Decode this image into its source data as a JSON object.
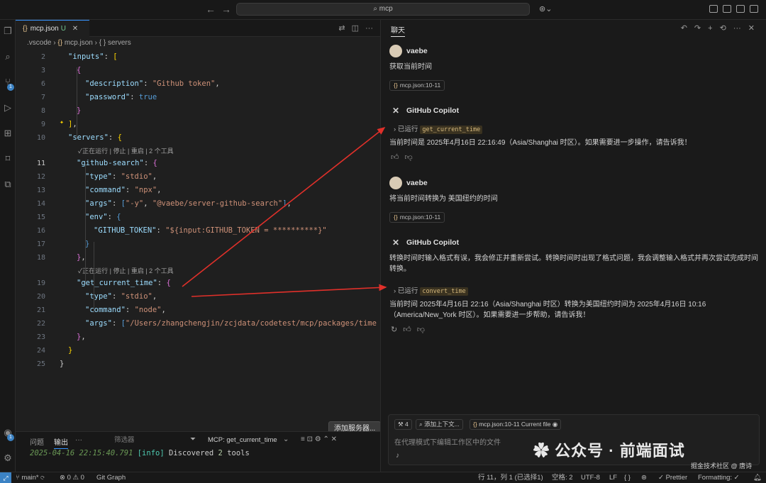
{
  "titlebar": {
    "search": "⌕ mcp"
  },
  "activity": {
    "scm_badge": "1",
    "account_badge": "1"
  },
  "editor": {
    "tab_label": "mcp.json",
    "tab_status": "U",
    "breadcrumb": [
      ".vscode",
      "mcp.json",
      "{ } servers"
    ],
    "lines": [
      {
        "n": "2",
        "html": "<span class='k'>\"inputs\"</span>: <span class='y'>[</span>"
      },
      {
        "n": "3",
        "html": "  <span class='p'>{</span>"
      },
      {
        "n": "6",
        "html": "    <span class='k'>\"description\"</span>: <span class='s'>\"Github token\"</span>,"
      },
      {
        "n": "7",
        "html": "    <span class='k'>\"password\"</span>: <span class='b'>true</span>"
      },
      {
        "n": "8",
        "html": "  <span class='p'>}</span>"
      },
      {
        "n": "9",
        "html": "<span class='y'>]</span>,"
      },
      {
        "n": "10",
        "html": "<span class='k'>\"servers\"</span>: <span class='y'>{</span>"
      },
      {
        "n": "11",
        "html": "  <span class='k'>\"github-search\"</span>: <span class='p'>{</span>"
      },
      {
        "n": "12",
        "html": "    <span class='k'>\"type\"</span>: <span class='s'>\"stdio\"</span>,"
      },
      {
        "n": "13",
        "html": "    <span class='k'>\"command\"</span>: <span class='s'>\"npx\"</span>,"
      },
      {
        "n": "14",
        "html": "    <span class='k'>\"args\"</span>: <span class='b'>[</span><span class='s'>\"-y\"</span>, <span class='s'>\"@vaebe/server-github-search\"</span><span class='b'>]</span>,"
      },
      {
        "n": "15",
        "html": "    <span class='k'>\"env\"</span>: <span class='b'>{</span>"
      },
      {
        "n": "16",
        "html": "      <span class='k'>\"GITHUB_TOKEN\"</span>: <span class='s'>\"${input:GITHUB_TOKEN = **********}\"</span>"
      },
      {
        "n": "17",
        "html": "    <span class='b'>}</span>"
      },
      {
        "n": "18",
        "html": "  <span class='p'>}</span>,"
      },
      {
        "n": "19",
        "html": "  <span class='k'>\"get_current_time\"</span>: <span class='p'>{</span>"
      },
      {
        "n": "20",
        "html": "    <span class='k'>\"type\"</span>: <span class='s'>\"stdio\"</span>,"
      },
      {
        "n": "21",
        "html": "    <span class='k'>\"command\"</span>: <span class='s'>\"node\"</span>,"
      },
      {
        "n": "22",
        "html": "    <span class='k'>\"args\"</span>: <span class='b'>[</span><span class='s'>\"/Users/zhangchengjin/zcjdata/codetest/mcp/packages/time</span>"
      },
      {
        "n": "23",
        "html": "  <span class='p'>}</span>,"
      },
      {
        "n": "24",
        "html": "<span class='y'>}</span>"
      },
      {
        "n": "25",
        "html": "}"
      },
      {
        "n": "26",
        "html": ""
      }
    ],
    "lens_1": "✓正在运行 | 停止 | 重启 | 2 个工具",
    "lens_2": "✓正在运行 | 停止 | 重启 | 2 个工具",
    "add_server": "添加服务器..."
  },
  "panel": {
    "tabs": [
      "问题",
      "输出",
      "···"
    ],
    "filter_placeholder": "筛选器",
    "channel": "MCP: get_current_time",
    "log_ts": "2025-04-16 22:15:40.791",
    "log_level": "[info]",
    "log_pre": "Discovered",
    "log_num": "2",
    "log_post": "tools"
  },
  "chat": {
    "title": "聊天",
    "user_name": "vaebe",
    "bot_name": "GitHub Copilot",
    "m1_text": "获取当前时间",
    "m1_ref": "mcp.json:10-11",
    "r1_ran": "已运行",
    "r1_tool": "get_current_time",
    "r1_text": "当前时间是 2025年4月16日 22:16:49（Asia/Shanghai 时区）。如果需要进一步操作，请告诉我！",
    "m2_text": "将当前时间转换为 美国纽约的时间",
    "m2_ref": "mcp.json:10-11",
    "r2_text1": "转换时间时输入格式有误，我会修正并重新尝试。转换时间时出现了格式问题，我会调整输入格式并再次尝试完成时间转换。",
    "r2_ran": "已运行",
    "r2_tool": "convert_time",
    "r2_text2": "当前时间 2025年4月16日 22:16（Asia/Shanghai 时区）转换为美国纽约时间为 2025年4月16日 10:16（America/New_York 时区）。如果需要进一步帮助，请告诉我！",
    "chip_tools": "4",
    "chip_context": "添加上下文...",
    "chip_file": "mcp.json:10-11 Current file",
    "placeholder": "在代理模式下编辑工作区中的文件"
  },
  "watermark": {
    "main": "公众号 · 前端面试",
    "sub": "掘金技术社区 @ 唐诗"
  },
  "status": {
    "branch": "main*",
    "problems": "⊗ 0 ⚠ 0",
    "gitgraph": "Git Graph",
    "position": "行 11，列 1 (已选择1)",
    "spaces": "空格: 2",
    "encoding": "UTF-8",
    "eol": "LF",
    "prettier": "✓ Prettier",
    "formatting": "Formatting: ✓"
  },
  "colors": {
    "accent": "#3794ff",
    "arrow": "#e0302a"
  }
}
